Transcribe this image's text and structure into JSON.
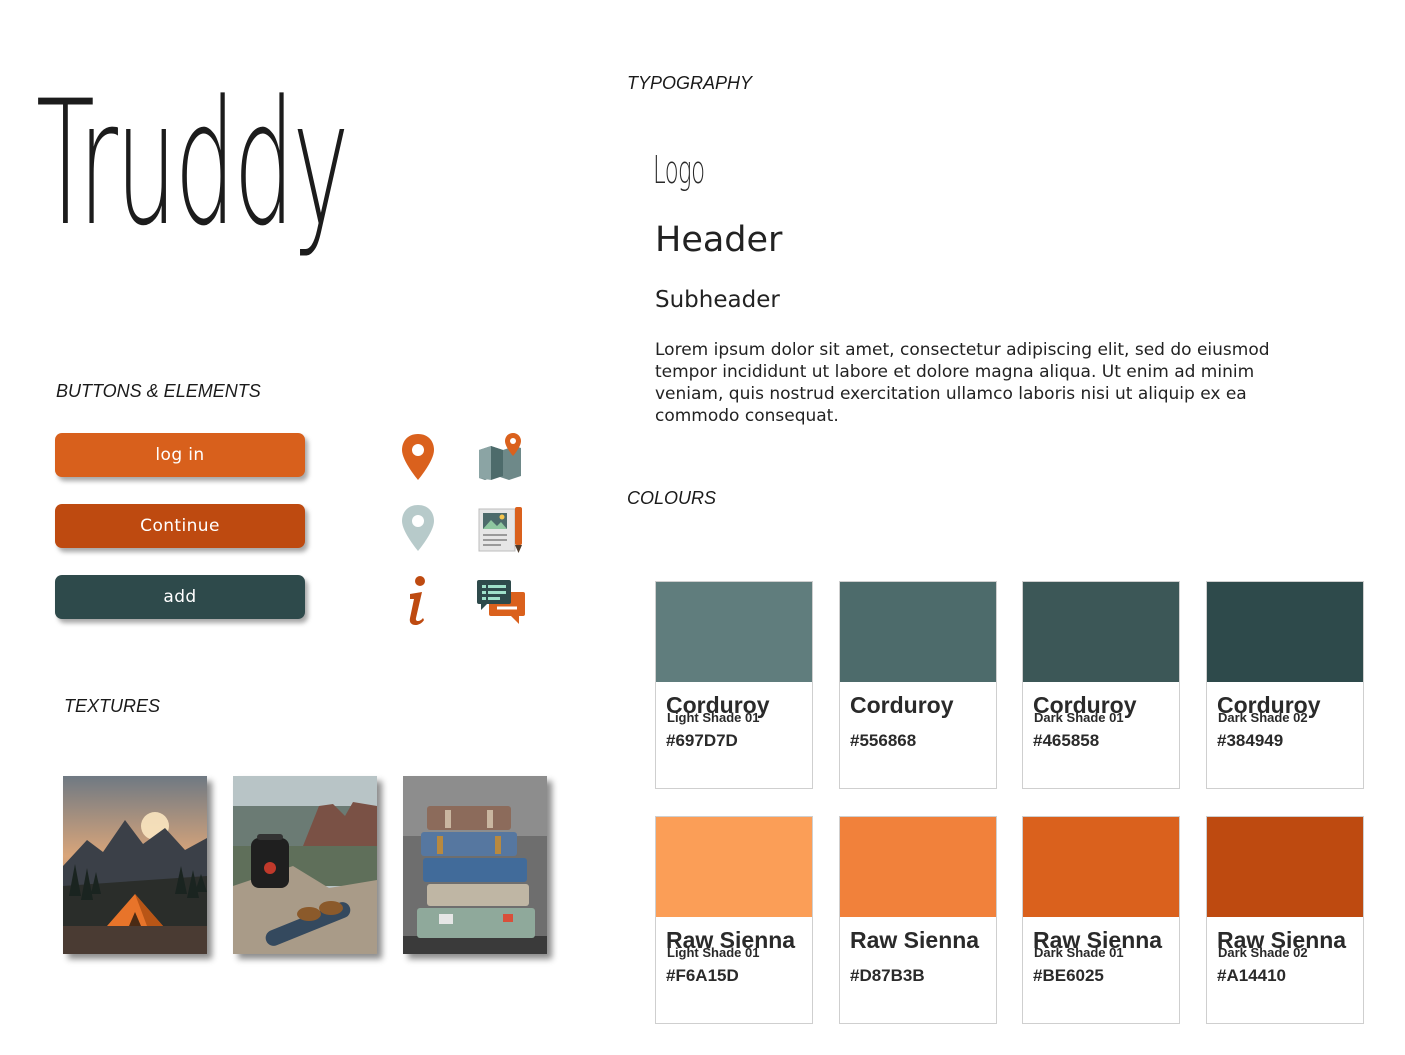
{
  "brand": {
    "title": "Truddy"
  },
  "sections": {
    "typography": "TYPOGRAPHY",
    "buttons": "BUTTONS & ELEMENTS",
    "textures": "TEXTURES",
    "colours": "COLOURS"
  },
  "typography": {
    "logo": "Logo",
    "header": "Header",
    "subheader": "Subheader",
    "body": "Lorem ipsum dolor sit amet, consectetur adipiscing elit, sed do eiusmod tempor incididunt ut labore et dolore magna aliqua. Ut enim ad minim veniam, quis nostrud exercitation ullamco laboris nisi ut aliquip ex ea commodo consequat."
  },
  "buttons": [
    {
      "label": "log in",
      "color": "#D8601C"
    },
    {
      "label": "Continue",
      "color": "#BE4A10"
    },
    {
      "label": "add",
      "color": "#2E4A4B"
    }
  ],
  "icons": [
    "map-pin-icon",
    "folded-map-icon",
    "map-pin-outline-icon",
    "photo-document-icon",
    "info-icon",
    "chat-icon"
  ],
  "textures": [
    "tent-mountain-photo",
    "backpack-hiking-photo",
    "stacked-suitcases-photo"
  ],
  "colours": [
    {
      "name": "Corduroy",
      "shade": "Light Shade 01",
      "hex": "#697D7D",
      "swatch": "#607D7D"
    },
    {
      "name": "Corduroy",
      "shade": "",
      "hex": "#556868",
      "swatch": "#4D6B6B"
    },
    {
      "name": "Corduroy",
      "shade": "Dark Shade 01",
      "hex": "#465858",
      "swatch": "#3C5757"
    },
    {
      "name": "Corduroy",
      "shade": "Dark Shade 02",
      "hex": "#384949",
      "swatch": "#2E4A4B"
    },
    {
      "name": "Raw Sienna",
      "shade": "Light Shade 01",
      "hex": "#F6A15D",
      "swatch": "#FB9E57"
    },
    {
      "name": "Raw Sienna",
      "shade": "",
      "hex": "#D87B3B",
      "swatch": "#F1813B"
    },
    {
      "name": "Raw Sienna",
      "shade": "Dark Shade 01",
      "hex": "#BE6025",
      "swatch": "#DA611D"
    },
    {
      "name": "Raw Sienna",
      "shade": "Dark Shade 02",
      "hex": "#A14410",
      "swatch": "#BE4A10"
    }
  ]
}
